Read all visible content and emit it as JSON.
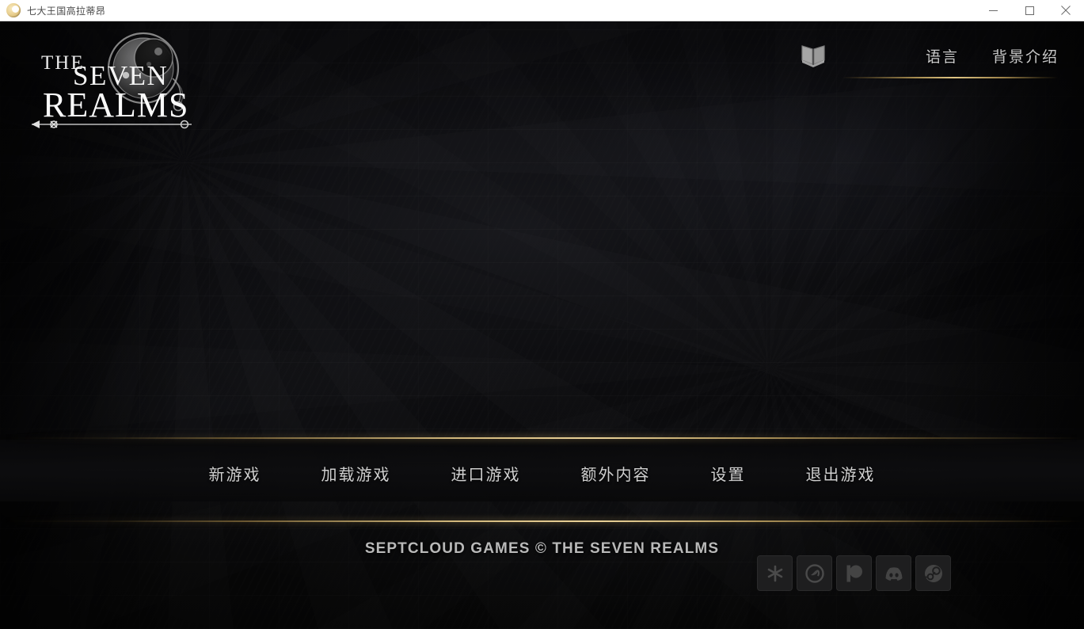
{
  "window": {
    "title": "七大王国高拉蒂昂",
    "app_icon": "moon-app-icon",
    "controls": {
      "minimize": "minimize-button",
      "maximize": "maximize-button",
      "close": "close-button"
    }
  },
  "logo": {
    "line1": "THE",
    "line2": "SEVEN",
    "line3": "REALMS",
    "emblem": "moon-orb-emblem"
  },
  "topnav": {
    "book_icon": "open-book-icon",
    "links": [
      {
        "label": "语言",
        "name": "nav-language"
      },
      {
        "label": "背景介绍",
        "name": "nav-background-intro"
      }
    ]
  },
  "menu": {
    "items": [
      {
        "label": "新游戏",
        "name": "menu-new-game"
      },
      {
        "label": "加载游戏",
        "name": "menu-load-game"
      },
      {
        "label": "进口游戏",
        "name": "menu-import-game"
      },
      {
        "label": "额外内容",
        "name": "menu-extras"
      },
      {
        "label": "设置",
        "name": "menu-settings"
      },
      {
        "label": "退出游戏",
        "name": "menu-quit-game"
      }
    ]
  },
  "footer": {
    "copyright": "SEPTCLOUD GAMES © THE SEVEN REALMS",
    "socials": [
      {
        "name": "asterisk-star-icon"
      },
      {
        "name": "twitter-circle-icon"
      },
      {
        "name": "patreon-icon"
      },
      {
        "name": "discord-icon"
      },
      {
        "name": "steam-icon"
      }
    ]
  },
  "colors": {
    "gold": "#e0c484",
    "gold_dim": "#8c702c",
    "text": "#cfcfcf",
    "background": "#0b0b0c",
    "titlebar_bg": "#ffffff",
    "titlebar_text": "#4a4a4a"
  }
}
